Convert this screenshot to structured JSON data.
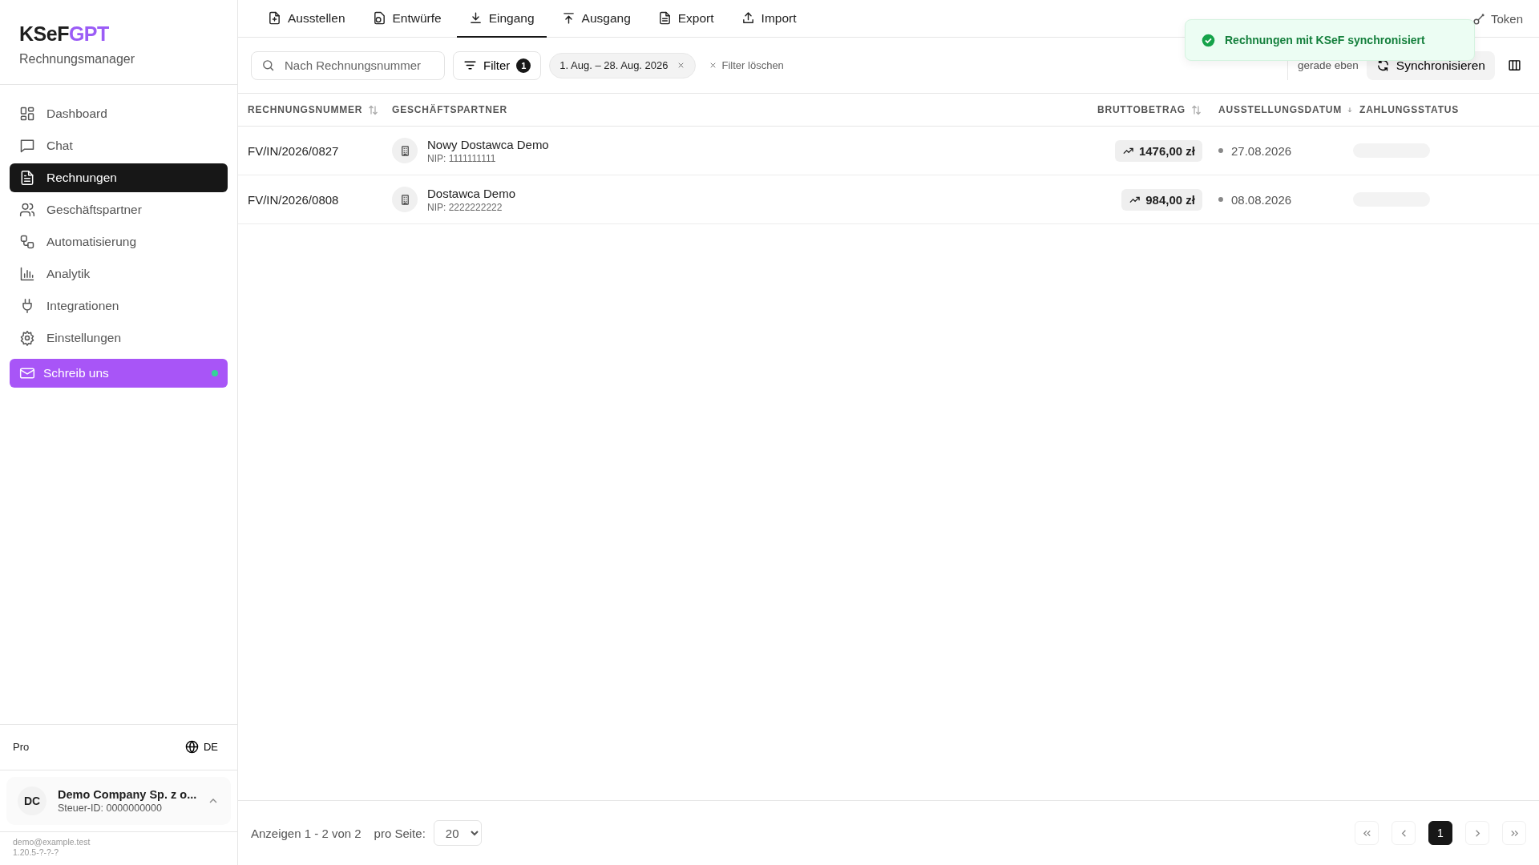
{
  "brand": {
    "name_main": "KSeF",
    "name_accent": "GPT",
    "subtitle": "Rechnungsmanager"
  },
  "sidebar": {
    "items": [
      {
        "label": "Dashboard",
        "selected": false
      },
      {
        "label": "Chat",
        "selected": false
      },
      {
        "label": "Rechnungen",
        "selected": true
      },
      {
        "label": "Geschäftspartner",
        "selected": false
      },
      {
        "label": "Automatisierung",
        "selected": false
      },
      {
        "label": "Analytik",
        "selected": false
      },
      {
        "label": "Integrationen",
        "selected": false
      },
      {
        "label": "Einstellungen",
        "selected": false
      }
    ],
    "contact_button": {
      "label": "Schreib uns",
      "online": true
    },
    "plan": "Pro",
    "language": "DE",
    "account": {
      "initials": "DC",
      "name": "Demo Company Sp. z o...",
      "tax_id": "Steuer-ID: 0000000000"
    },
    "email": "demo@example.test",
    "version": "1.20.5-?-?-?"
  },
  "tabs": [
    {
      "label": "Ausstellen",
      "selected": false
    },
    {
      "label": "Entwürfe",
      "selected": false
    },
    {
      "label": "Eingang",
      "selected": true
    },
    {
      "label": "Ausgang",
      "selected": false
    },
    {
      "label": "Export",
      "selected": false
    },
    {
      "label": "Import",
      "selected": false
    }
  ],
  "token_link": "Token",
  "search": {
    "placeholder": "Nach Rechnungsnummer"
  },
  "filter_button": {
    "label": "Filter",
    "count": "1"
  },
  "date_chip": "1. Aug. – 28. Aug. 2026",
  "clear_filters": "Filter löschen",
  "sync": {
    "last_sync": "gerade eben",
    "button": "Synchronisieren"
  },
  "toast": {
    "message": "Rechnungen mit KSeF synchronisiert"
  },
  "table": {
    "columns": [
      {
        "label": "RECHNUNGSNUMMER",
        "sortable": true,
        "sorted": false
      },
      {
        "label": "GESCHÄFTSPARTNER",
        "sortable": false,
        "sorted": false
      },
      {
        "label": "BRUTTOBETRAG",
        "sortable": true,
        "sorted": false
      },
      {
        "label": "AUSSTELLUNGSDATUM",
        "sortable": true,
        "sorted": true
      },
      {
        "label": "ZAHLUNGSSTATUS",
        "sortable": false,
        "sorted": false
      }
    ],
    "rows": [
      {
        "number": "FV/IN/2026/0827",
        "partner": "Nowy Dostawca Demo",
        "nip": "NIP: 1111111111",
        "amount": "1476,00 zł",
        "date": "27.08.2026"
      },
      {
        "number": "FV/IN/2026/0808",
        "partner": "Dostawca Demo",
        "nip": "NIP: 2222222222",
        "amount": "984,00 zł",
        "date": "08.08.2026"
      }
    ]
  },
  "pagination": {
    "summary": "Anzeigen 1 - 2 von 2",
    "per_page_label": "pro Seite:",
    "per_page": "20",
    "pages": [
      {
        "label": "1",
        "selected": true
      }
    ]
  }
}
